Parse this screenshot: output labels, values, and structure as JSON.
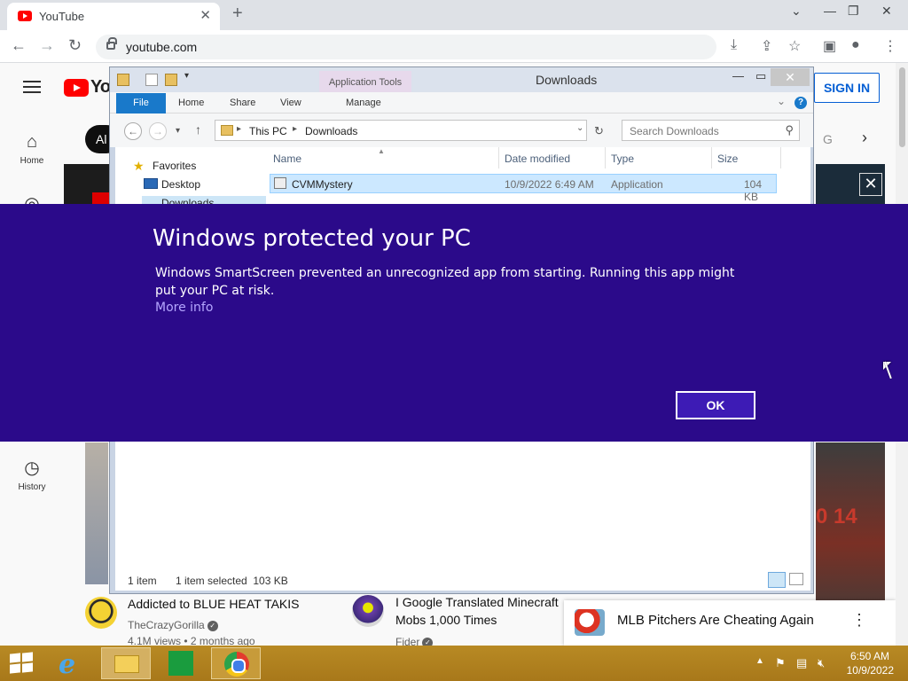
{
  "browser": {
    "tab_title": "YouTube",
    "tab_close": "✕",
    "new_tab": "+",
    "url": "youtube.com",
    "window_controls": [
      "⌄",
      "—",
      "❐",
      "✕"
    ]
  },
  "youtube": {
    "logo_text": "Yo",
    "sign_in": "SIGN IN",
    "sidebar": [
      {
        "label": "Home",
        "icon": "home-icon"
      },
      {
        "label": "History",
        "icon": "history-icon"
      }
    ],
    "chip_all": "Al",
    "chip_partial": "G",
    "videos": [
      {
        "title": "Addicted to BLUE HEAT TAKIS",
        "channel": "TheCrazyGorilla",
        "meta": "4.1M views • 2 months ago"
      },
      {
        "title_line1": "I Google Translated Minecraft",
        "title_line2": "Mobs 1,000 Times",
        "channel": "Fider"
      }
    ],
    "miniplayer_title": "MLB Pitchers Are Cheating Again",
    "thumb_number": "0  14  "
  },
  "explorer": {
    "title": "Downloads",
    "app_tools": "Application Tools",
    "ribbon_tabs": [
      "File",
      "Home",
      "Share",
      "View",
      "Manage"
    ],
    "breadcrumb": [
      "This PC",
      "Downloads"
    ],
    "search_placeholder": "Search Downloads",
    "nav": {
      "favorites": "Favorites",
      "desktop": "Desktop",
      "downloads": "Downloads"
    },
    "columns": [
      "Name",
      "Date modified",
      "Type",
      "Size"
    ],
    "files": [
      {
        "name": "CVMMystery",
        "date": "10/9/2022 6:49 AM",
        "type": "Application",
        "size": "104 KB"
      }
    ],
    "status_items": "1 item",
    "status_selected": "1 item selected  103 KB"
  },
  "smartscreen": {
    "title": "Windows protected your PC",
    "body": "Windows SmartScreen prevented an unrecognized app from starting. Running this app might put your PC at risk.",
    "more_info": "More info",
    "ok": "OK",
    "background": "#2b0a8a"
  },
  "taskbar": {
    "time": "6:50 AM",
    "date": "10/9/2022",
    "background": "#b88a24"
  }
}
